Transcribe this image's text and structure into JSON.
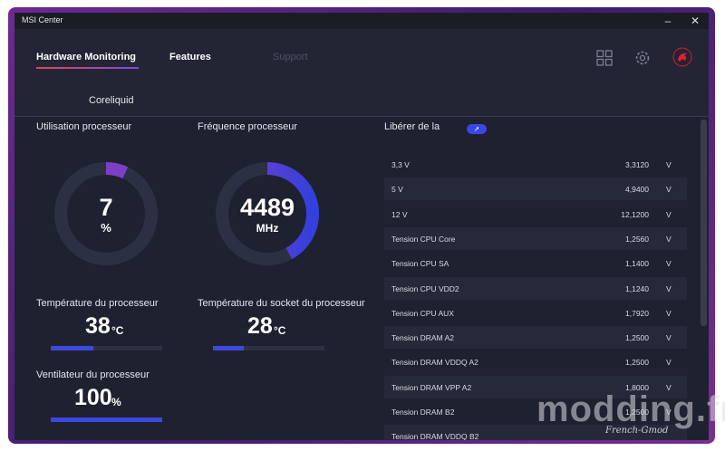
{
  "window": {
    "title": "MSI Center"
  },
  "nav": {
    "tab1": "Hardware Monitoring",
    "tab2": "Features",
    "tab3": "Support"
  },
  "header": {
    "subtitle": "Coreliquid",
    "icons": [
      "grid-icon",
      "gear-icon",
      "dragon-logo-icon"
    ]
  },
  "cpu_usage": {
    "label": "Utilisation processeur",
    "value": "7",
    "unit": "%",
    "fraction": 0.07
  },
  "cpu_freq": {
    "label": "Fréquence processeur",
    "value": "4489",
    "unit": "MHz",
    "fraction": 0.42
  },
  "cpu_temp": {
    "label": "Température du processeur",
    "value": "38",
    "unit": "°C",
    "fraction": 0.38
  },
  "socket_temp": {
    "label": "Température du socket du processeur",
    "value": "28",
    "unit": "°C",
    "fraction": 0.28
  },
  "cpu_fan": {
    "label": "Ventilateur du processeur",
    "value": "100",
    "unit": "%",
    "fraction": 1.0
  },
  "boost": {
    "label": "Libérer de la"
  },
  "voltages": [
    {
      "name": "3,3 V",
      "value": "3,3120",
      "unit": "V"
    },
    {
      "name": "5 V",
      "value": "4,9400",
      "unit": "V"
    },
    {
      "name": "12 V",
      "value": "12,1200",
      "unit": "V"
    },
    {
      "name": "Tension CPU Core",
      "value": "1,2560",
      "unit": "V"
    },
    {
      "name": "Tension CPU SA",
      "value": "1,1400",
      "unit": "V"
    },
    {
      "name": "Tension CPU VDD2",
      "value": "1,1240",
      "unit": "V"
    },
    {
      "name": "Tension CPU AUX",
      "value": "1,7920",
      "unit": "V"
    },
    {
      "name": "Tension DRAM A2",
      "value": "1,2500",
      "unit": "V"
    },
    {
      "name": "Tension DRAM VDDQ A2",
      "value": "1,2500",
      "unit": "V"
    },
    {
      "name": "Tension DRAM VPP A2",
      "value": "1,8000",
      "unit": "V"
    },
    {
      "name": "Tension DRAM B2",
      "value": "1,2500",
      "unit": "V"
    },
    {
      "name": "Tension DRAM VDDQ B2",
      "value": "",
      "unit": ""
    }
  ],
  "watermark": {
    "text": "modding.fr",
    "signature": "French-Gmod"
  }
}
